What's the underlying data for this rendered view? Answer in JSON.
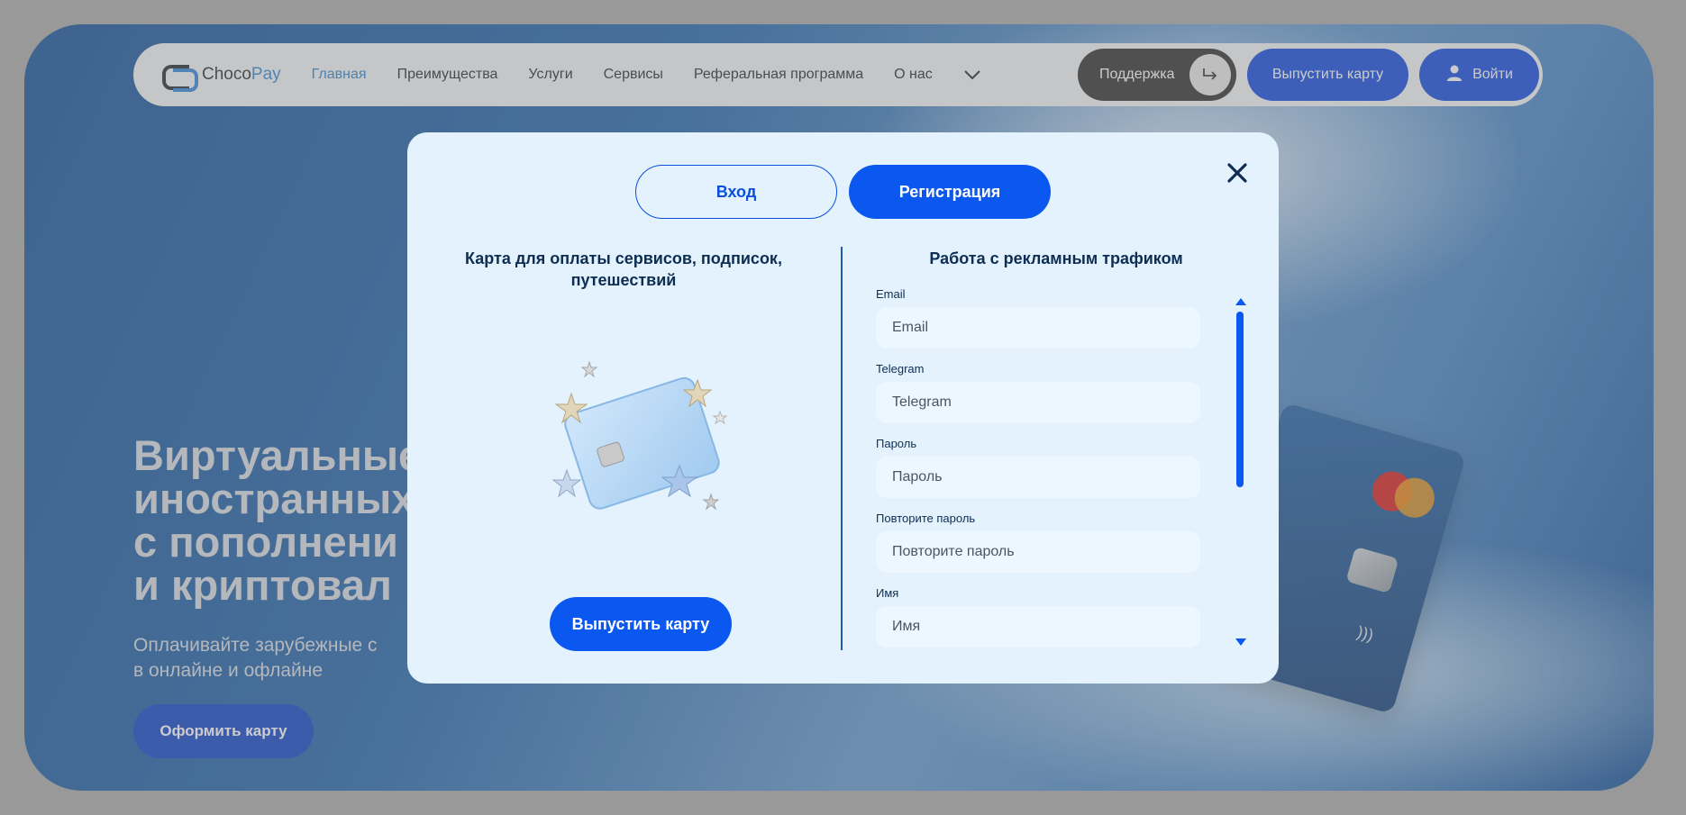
{
  "nav": {
    "logo_choco": "Choco",
    "logo_pay": "Pay",
    "links": [
      "Главная",
      "Преимущества",
      "Услуги",
      "Сервисы",
      "Реферальная программа",
      "О нас"
    ],
    "support_label": "Поддержка",
    "issue_card_label": "Выпустить карту",
    "login_label": "Войти"
  },
  "hero": {
    "title": "Виртуальные\nиностранных\nс пополнени\nи криптовал",
    "subtitle": "Оплачивайте зарубежные с\nв онлайне и офлайне",
    "cta_label": "Оформить карту"
  },
  "modal": {
    "tab_login": "Вход",
    "tab_register": "Регистрация",
    "left_title": "Карта для оплаты сервисов, подписок, путешествий",
    "left_button": "Выпустить карту",
    "right_title": "Работа с рекламным трафиком",
    "fields": [
      {
        "label": "Email",
        "placeholder": "Email"
      },
      {
        "label": "Telegram",
        "placeholder": "Telegram"
      },
      {
        "label": "Пароль",
        "placeholder": "Пароль"
      },
      {
        "label": "Повторите пароль",
        "placeholder": "Повторите пароль"
      },
      {
        "label": "Имя",
        "placeholder": "Имя"
      }
    ]
  },
  "colors": {
    "primary": "#0a58f0",
    "nav_active": "#2a7fd0",
    "modal_bg": "#e3f2fd",
    "heading": "#0d2e52"
  },
  "icons": [
    "chevron-down-icon",
    "logout-arrow-icon",
    "user-icon",
    "close-icon",
    "scroll-up-icon",
    "scroll-down-icon"
  ]
}
